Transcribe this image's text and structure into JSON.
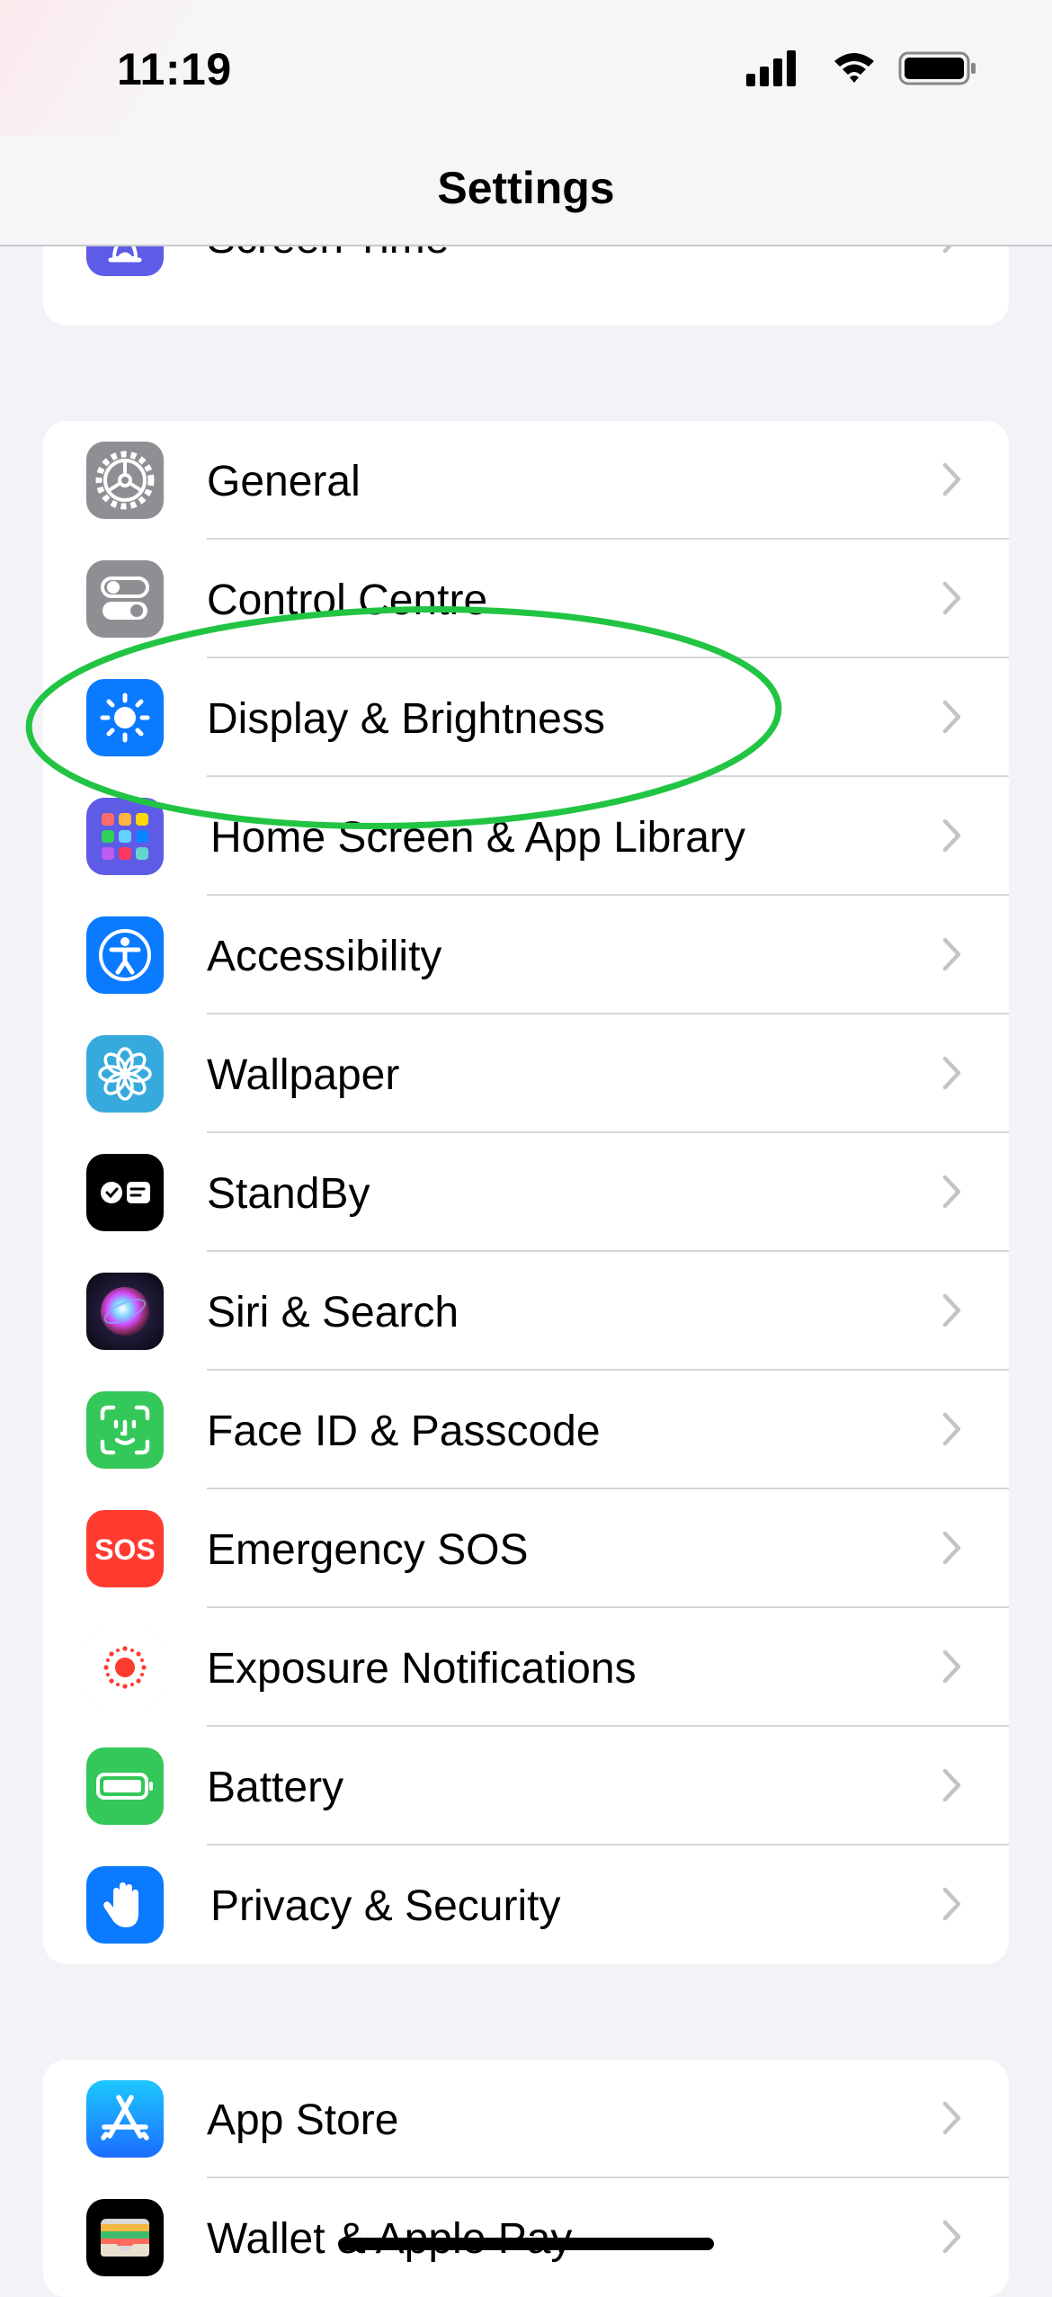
{
  "status_bar": {
    "time": "11:19"
  },
  "nav": {
    "title": "Settings"
  },
  "groups": [
    {
      "rows": [
        {
          "label": "Screen Time"
        }
      ]
    },
    {
      "rows": [
        {
          "label": "General"
        },
        {
          "label": "Control Centre"
        },
        {
          "label": "Display & Brightness"
        },
        {
          "label": "Home Screen & App Library"
        },
        {
          "label": "Accessibility"
        },
        {
          "label": "Wallpaper"
        },
        {
          "label": "StandBy"
        },
        {
          "label": "Siri & Search"
        },
        {
          "label": "Face ID & Passcode"
        },
        {
          "label": "Emergency SOS"
        },
        {
          "label": "Exposure Notifications"
        },
        {
          "label": "Battery"
        },
        {
          "label": "Privacy & Security"
        }
      ]
    },
    {
      "rows": [
        {
          "label": "App Store"
        },
        {
          "label": "Wallet & Apple Pay"
        }
      ]
    }
  ],
  "icons": {
    "screen_time": {
      "name": "hourglass-icon",
      "color": "#5e5ce6"
    },
    "general": {
      "name": "gear-icon",
      "color": "#8e8e93"
    },
    "control_centre": {
      "name": "toggles-icon",
      "color": "#8e8e93"
    },
    "display": {
      "name": "sun-icon",
      "color": "#0a7aff"
    },
    "home_screen": {
      "name": "app-grid-icon",
      "color": "#5e5ce6"
    },
    "accessibility": {
      "name": "accessibility-person-icon",
      "color": "#0a7aff"
    },
    "wallpaper": {
      "name": "flower-icon",
      "color": "#36aadc"
    },
    "standby": {
      "name": "standby-icon",
      "color": "#000000"
    },
    "siri": {
      "name": "siri-orb-icon",
      "color": "#1c1c2e"
    },
    "faceid": {
      "name": "face-id-icon",
      "color": "#34c759"
    },
    "sos": {
      "name": "sos-icon",
      "color": "#ff3b30",
      "text": "SOS"
    },
    "exposure": {
      "name": "exposure-notification-icon",
      "color": "#ff3b30"
    },
    "battery": {
      "name": "battery-icon",
      "color": "#34c759"
    },
    "privacy": {
      "name": "raised-hand-icon",
      "color": "#0a7aff"
    },
    "app_store": {
      "name": "app-store-icon",
      "color": "#1a8cff"
    },
    "wallet": {
      "name": "wallet-icon",
      "color": "#000000"
    }
  },
  "annotation": {
    "name": "highlight-ellipse",
    "color": "#22c443"
  }
}
